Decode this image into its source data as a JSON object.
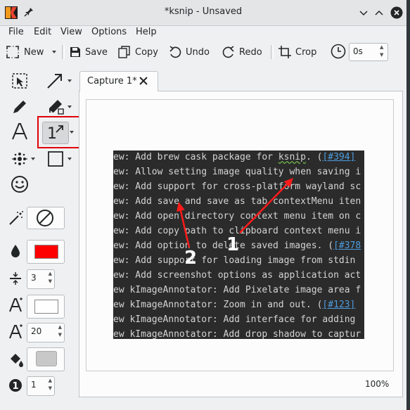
{
  "window": {
    "title": "*ksnip - Unsaved"
  },
  "menu": [
    "File",
    "Edit",
    "View",
    "Options",
    "Help"
  ],
  "toolbar": {
    "new_label": "New",
    "save_label": "Save",
    "copy_label": "Copy",
    "undo_label": "Undo",
    "redo_label": "Redo",
    "crop_label": "Crop",
    "delay_value": "0s"
  },
  "tab": {
    "label": "Capture 1*"
  },
  "settings": {
    "width_value": "3",
    "font_size_value": "20",
    "number_value": "1"
  },
  "colors": {
    "stroke": "#ff0000",
    "highlight": "#e0000a",
    "arrow": "#ff1a1a"
  },
  "capture": {
    "lines": [
      {
        "text": "ew: Add brew cask package for ",
        "wavy": "ksnip",
        "post": ". (",
        "link": "[#394]",
        "tail": ""
      },
      {
        "text": "ew: Allow setting image quality when saving i",
        "wavy": "",
        "post": "",
        "link": "",
        "tail": ""
      },
      {
        "text": "ew: Add support for cross-platform wayland sc",
        "wavy": "",
        "post": "",
        "link": "",
        "tail": ""
      },
      {
        "text": "ew: Add save and save as tab contextMenu iten",
        "wavy": "",
        "post": "",
        "link": "",
        "tail": ""
      },
      {
        "text": "ew: Add open directory context menu item on c",
        "wavy": "",
        "post": "",
        "link": "",
        "tail": ""
      },
      {
        "text": "ew: Add copy path to clipboard context menu i",
        "wavy": "",
        "post": "",
        "link": "",
        "tail": ""
      },
      {
        "text": "ew: Add option to delete saved images. (",
        "wavy": "",
        "post": "",
        "link": "[#378",
        "tail": ""
      },
      {
        "text": "ew: Add support for loading image from stdin",
        "wavy": "",
        "post": "",
        "link": "",
        "tail": ""
      },
      {
        "text": "ew: Add screenshot options as application act",
        "wavy": "",
        "post": "",
        "link": "",
        "tail": ""
      },
      {
        "text": "ew kImageAnnotator: Add Pixelate image area f",
        "wavy": "",
        "post": "",
        "link": "",
        "tail": ""
      },
      {
        "text": "ew kImageAnnotator: Zoom in and out. (",
        "wavy": "",
        "post": "",
        "link": "[#123]",
        "tail": ""
      },
      {
        "text": "ew kImageAnnotator: Add interface for adding",
        "wavy": "",
        "post": "",
        "link": "",
        "tail": ""
      },
      {
        "text": "ew kImageAnnotator: Add drop shadow to captur",
        "wavy": "",
        "post": "",
        "link": "",
        "tail": ""
      }
    ],
    "annotation_1": "1",
    "annotation_2": "2"
  },
  "zoom": "100%"
}
